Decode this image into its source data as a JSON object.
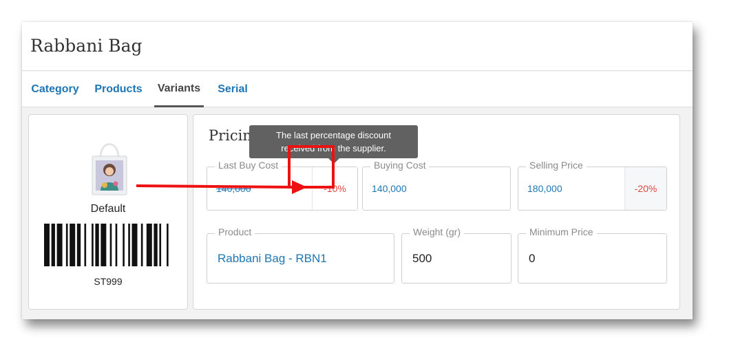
{
  "window": {
    "title": "Rabbani Bag"
  },
  "tabs": [
    {
      "label": "Category",
      "active": false
    },
    {
      "label": "Products",
      "active": false
    },
    {
      "label": "Variants",
      "active": true
    },
    {
      "label": "Serial",
      "active": false
    }
  ],
  "variant": {
    "label": "Default",
    "barcode": "ST999",
    "image_icon": "tote-bag-image"
  },
  "pricing": {
    "title": "Pricing",
    "last_buy_cost": {
      "label": "Last Buy Cost",
      "value": "140,000",
      "discount": "-10%"
    },
    "buying_cost": {
      "label": "Buying Cost",
      "value": "140,000"
    },
    "selling_price": {
      "label": "Selling Price",
      "value": "180,000",
      "discount": "-20%"
    }
  },
  "details": {
    "product": {
      "label": "Product",
      "value": "Rabbani Bag - RBN1"
    },
    "weight": {
      "label": "Weight (gr)",
      "value": "500"
    },
    "minimum_price": {
      "label": "Minimum Price",
      "value": "0"
    }
  },
  "tooltip": {
    "line1": "The last percentage discount",
    "line2": "received from the supplier."
  },
  "annotation": {
    "color": "#ee1111"
  },
  "colors": {
    "link": "#1e76b5",
    "discount": "#e0463e",
    "tooltip_bg": "#616161"
  }
}
